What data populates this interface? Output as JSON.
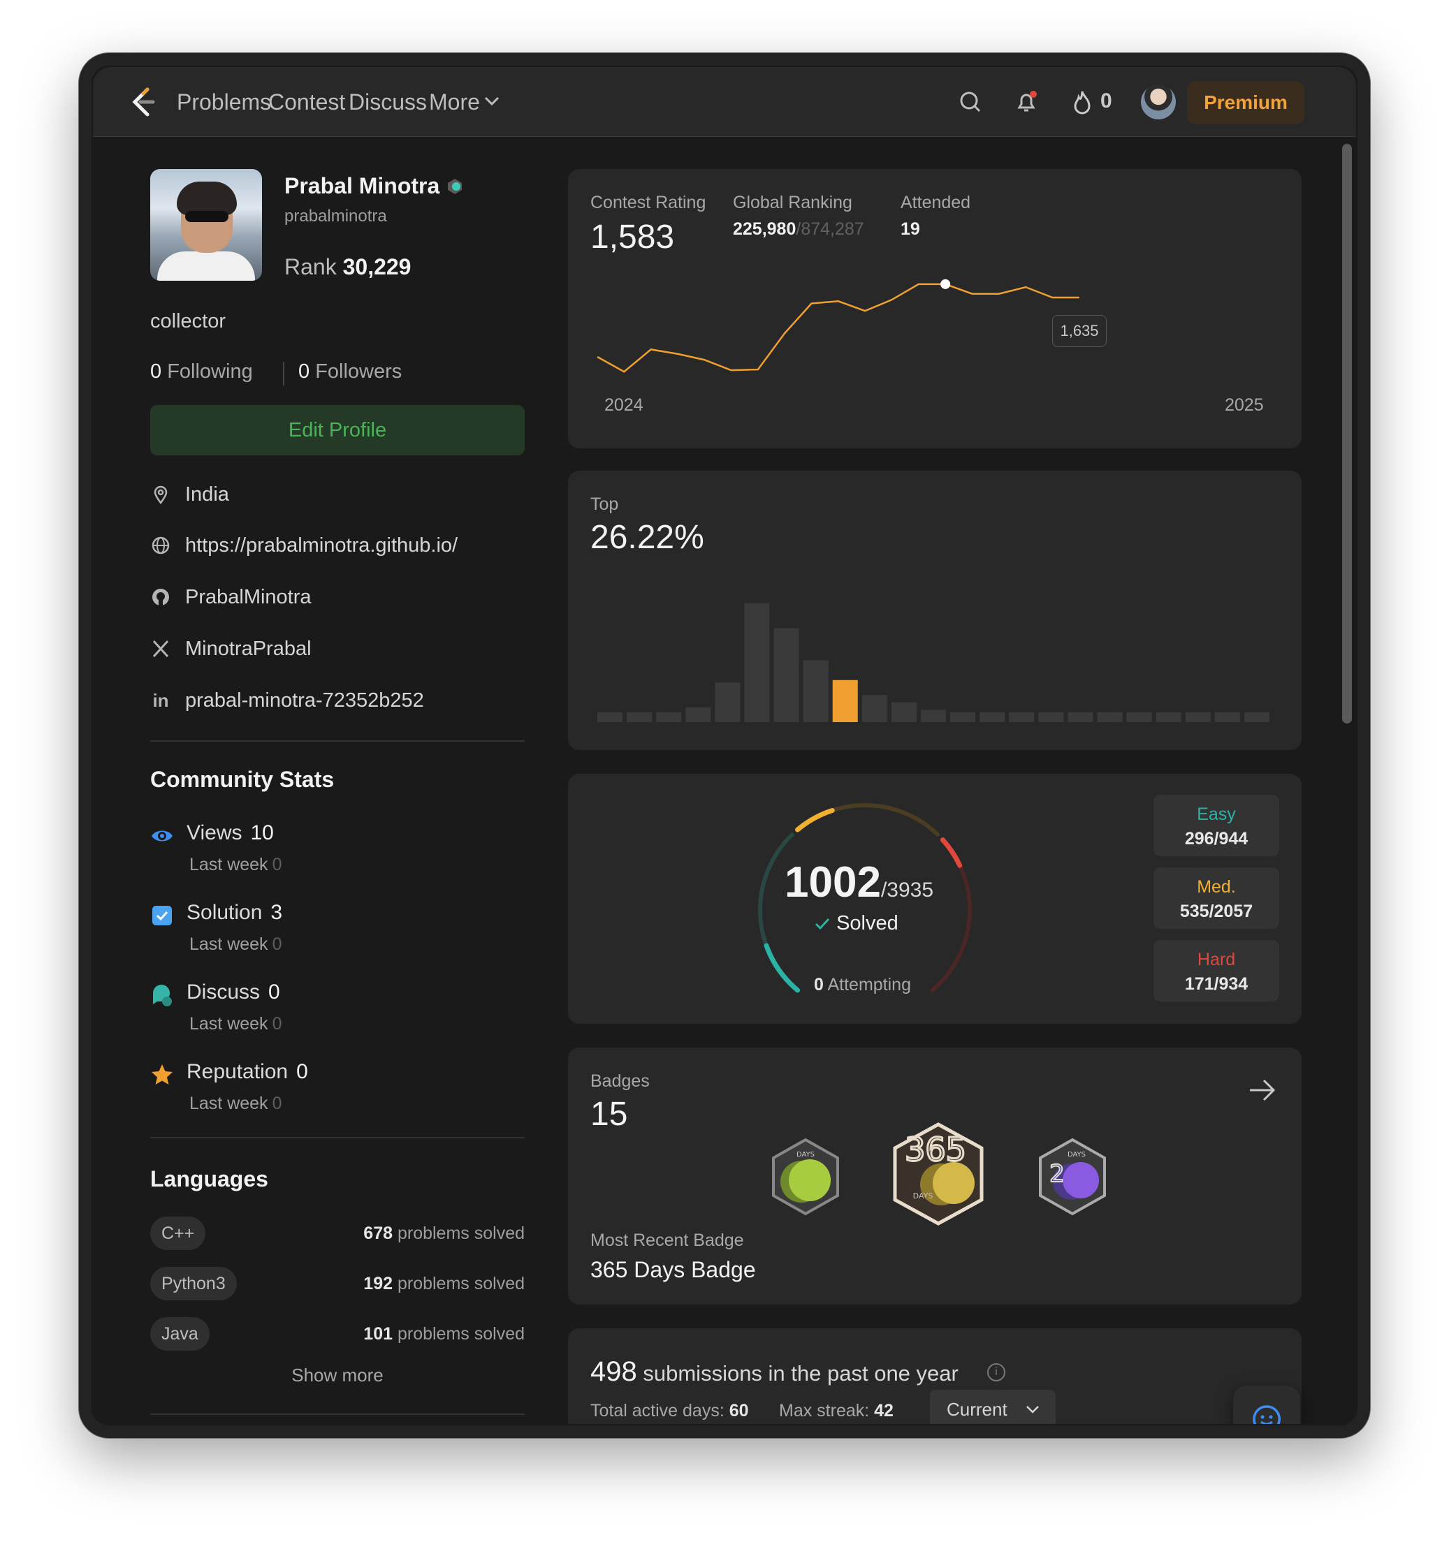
{
  "nav": {
    "links": [
      "Problems",
      "Contest",
      "Discuss",
      "More"
    ],
    "streak": "0",
    "premium": "Premium"
  },
  "profile": {
    "name": "Prabal Minotra",
    "username": "prabalminotra",
    "rank_label": "Rank",
    "rank": "30,229",
    "about": "collector",
    "following_count": "0",
    "following_label": "Following",
    "followers_count": "0",
    "followers_label": "Followers",
    "edit_button": "Edit Profile",
    "location": "India",
    "website": "https://prabalminotra.github.io/",
    "github": "PrabalMinotra",
    "twitter": "MinotraPrabal",
    "linkedin": "prabal-minotra-72352b252"
  },
  "community": {
    "title": "Community Stats",
    "last_week_label": "Last week",
    "items": [
      {
        "label": "Views",
        "value": "10",
        "last_week": "0",
        "icon": "eye-icon",
        "color": "#3d8ef0"
      },
      {
        "label": "Solution",
        "value": "3",
        "last_week": "0",
        "icon": "solution-check-icon",
        "color": "#4aa3f0"
      },
      {
        "label": "Discuss",
        "value": "0",
        "last_week": "0",
        "icon": "discuss-bubble-icon",
        "color": "#35b5a8"
      },
      {
        "label": "Reputation",
        "value": "0",
        "last_week": "0",
        "icon": "star-icon",
        "color": "#f0a030"
      }
    ]
  },
  "languages": {
    "title": "Languages",
    "suffix": "problems solved",
    "items": [
      {
        "name": "C++",
        "count": "678"
      },
      {
        "name": "Python3",
        "count": "192"
      },
      {
        "name": "Java",
        "count": "101"
      }
    ],
    "show_more": "Show more"
  },
  "contest": {
    "rating_label": "Contest Rating",
    "rating": "1,583",
    "ranking_label": "Global Ranking",
    "ranking": "225,980",
    "ranking_total": "/874,287",
    "attended_label": "Attended",
    "attended": "19",
    "tooltip": "1,635",
    "x_start": "2024",
    "x_end": "2025"
  },
  "chart_data": [
    {
      "type": "line",
      "title": "",
      "x": [
        "2024",
        "",
        "",
        "",
        "",
        "",
        "",
        "",
        "",
        "",
        "",
        "",
        "",
        "",
        "",
        "",
        "",
        "",
        "2025"
      ],
      "values": [
        1508,
        1488,
        1518,
        1512,
        1504,
        1490,
        1491,
        1540,
        1580,
        1583,
        1570,
        1585,
        1606,
        1606,
        1593,
        1593,
        1602,
        1588,
        1588
      ],
      "highlight": {
        "index": 13,
        "label": "1,635"
      },
      "color": "#f0a030"
    },
    {
      "type": "bar",
      "title": "Top",
      "label_value": "26.22%",
      "values": [
        4,
        4,
        4,
        6,
        16,
        48,
        38,
        25,
        17,
        11,
        8,
        5,
        4,
        4,
        4,
        4,
        4,
        4,
        4,
        4,
        4,
        4,
        4,
        4,
        4,
        4,
        4,
        4,
        4,
        4,
        4,
        4,
        4,
        4,
        4
      ],
      "highlight_index": 8,
      "bar_color": "#3a3a3a",
      "highlight_color": "#f0a030"
    }
  ],
  "solved": {
    "count": "1002",
    "total": "/3935",
    "label": "Solved",
    "attempting_count": "0",
    "attempting_label": "Attempting",
    "easy": {
      "name": "Easy",
      "value": "296/944",
      "color": "#2bb3a6",
      "solved": 296,
      "total": 944
    },
    "medium": {
      "name": "Med.",
      "value": "535/2057",
      "color": "#f0b030",
      "solved": 535,
      "total": 2057
    },
    "hard": {
      "name": "Hard",
      "value": "171/934",
      "color": "#e0483e",
      "solved": 171,
      "total": 934
    }
  },
  "badges": {
    "title": "Badges",
    "count": "15",
    "recent_label": "Most Recent Badge",
    "recent_name": "365 Days Badge",
    "items": [
      {
        "icon": "50-days-badge-icon",
        "color": "#a8cc40"
      },
      {
        "icon": "365-days-badge-icon",
        "color": "#d4b84a"
      },
      {
        "icon": "200-days-badge-icon",
        "color": "#8a5ae0"
      }
    ]
  },
  "submissions": {
    "count": "498",
    "text": "submissions in the past one year",
    "active_label": "Total active days:",
    "active_days": "60",
    "streak_label": "Max streak:",
    "max_streak": "42",
    "select": "Current"
  }
}
